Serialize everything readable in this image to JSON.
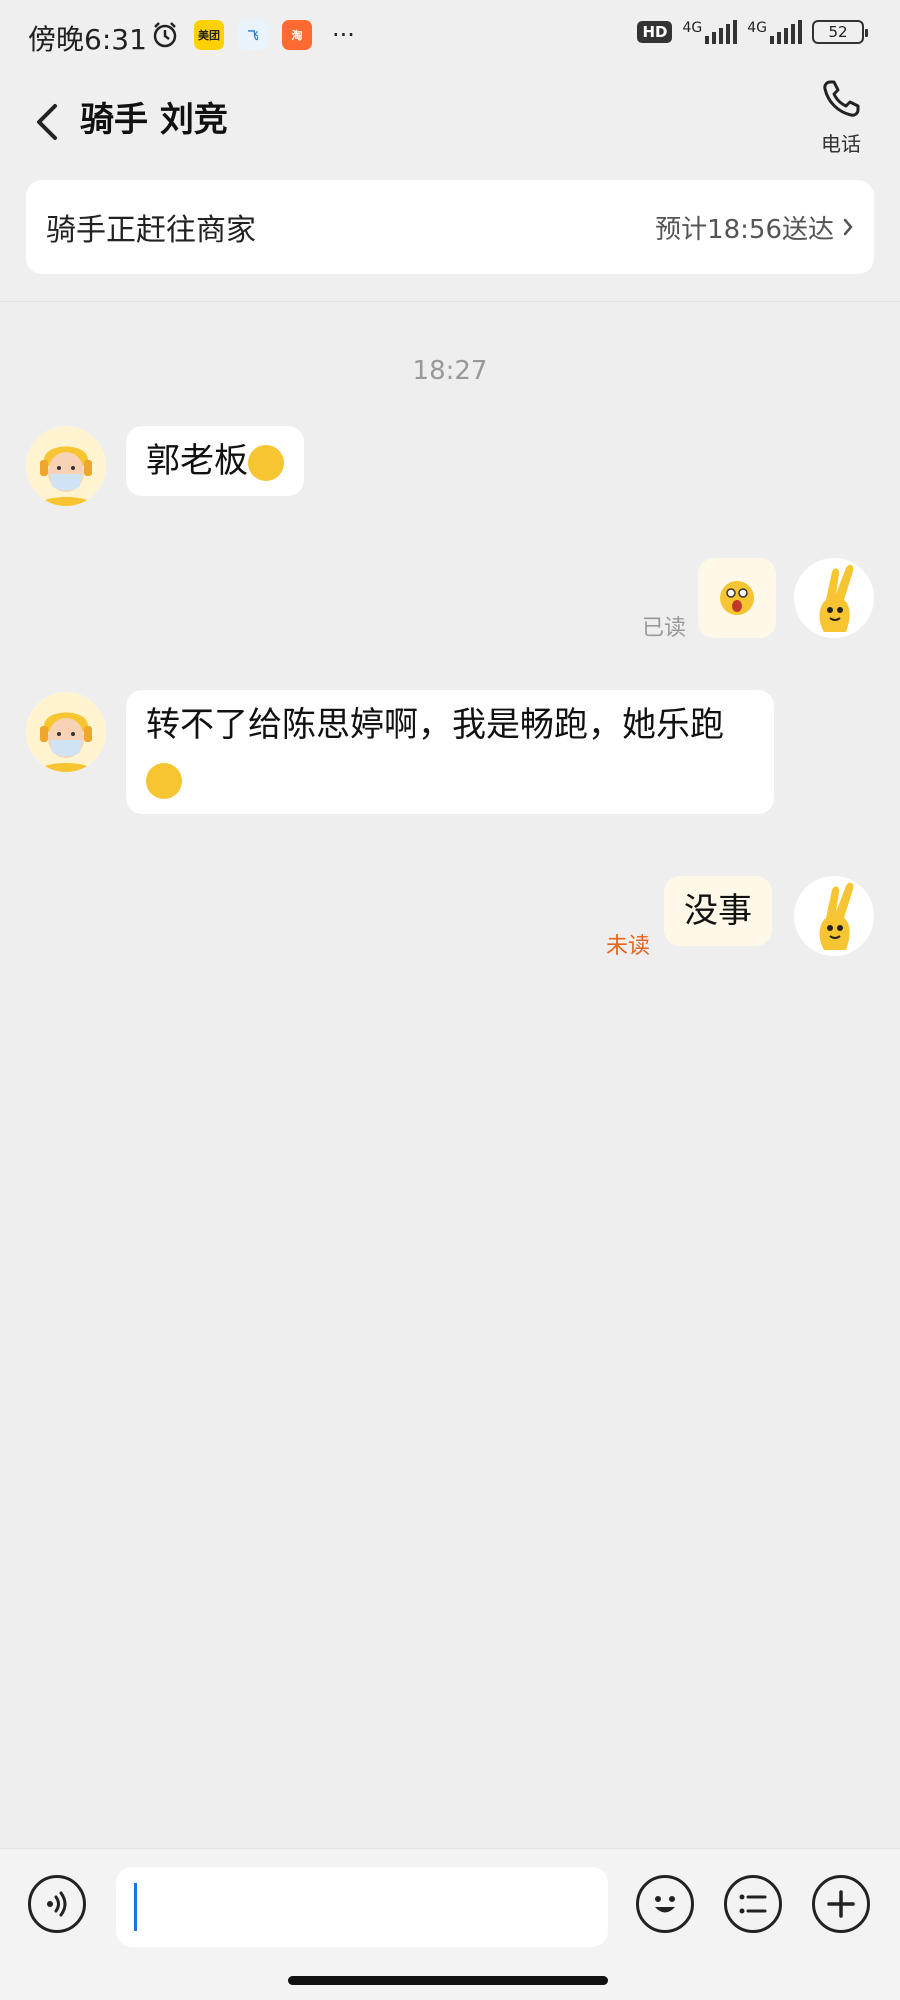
{
  "status_bar": {
    "time": "傍晚6:31",
    "apps": [
      "美团",
      "飞",
      "淘"
    ],
    "more": "···",
    "hd": "HD",
    "network1": "4G",
    "network2": "4G",
    "battery": "52"
  },
  "header": {
    "title": "骑手 刘竞",
    "phone_label": "电话"
  },
  "delivery": {
    "status": "骑手正赶往商家",
    "eta": "预计18:56送达"
  },
  "chat": {
    "timestamp": "18:27",
    "messages": [
      {
        "side": "left",
        "text": "郭老板"
      },
      {
        "side": "right",
        "read_status": "已读"
      },
      {
        "side": "left",
        "text": "转不了给陈思婷啊，我是畅跑，她乐跑"
      },
      {
        "side": "right",
        "text": "没事",
        "read_status": "未读"
      }
    ]
  },
  "colors": {
    "unread": "#e8641b",
    "read": "#999999",
    "mine_bubble": "#fdf8e8",
    "cursor": "#1a73e8"
  },
  "input": {
    "value": "",
    "placeholder": ""
  }
}
